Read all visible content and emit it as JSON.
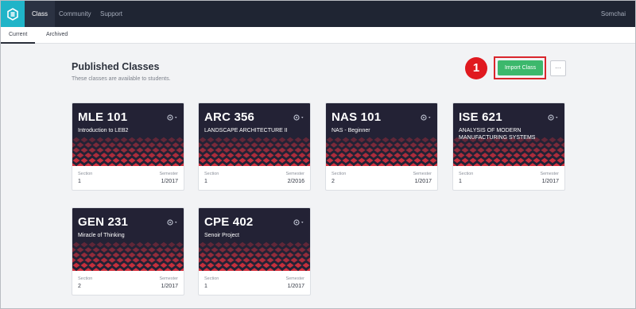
{
  "topnav": {
    "items": [
      "Class",
      "Community",
      "Support"
    ],
    "user": "Somchai"
  },
  "subnav": {
    "tabs": [
      "Current",
      "Archived"
    ]
  },
  "page": {
    "title": "Published Classes",
    "subtitle": "These classes are available to students."
  },
  "actions": {
    "marker": "1",
    "import_label": "Import Class",
    "more_label": "···"
  },
  "card_labels": {
    "section": "Section",
    "semester": "Semester"
  },
  "classes": [
    {
      "code": "MLE 101",
      "name": "Introduction to LEB2",
      "section": "1",
      "semester": "1/2017"
    },
    {
      "code": "ARC 356",
      "name": "LANDSCAPE ARCHITECTURE II",
      "section": "1",
      "semester": "2/2016"
    },
    {
      "code": "NAS 101",
      "name": "NAS - Beginner",
      "section": "2",
      "semester": "1/2017"
    },
    {
      "code": "ISE 621",
      "name": "ANALYSIS OF MODERN MANUFACTURING SYSTEMS",
      "section": "1",
      "semester": "1/2017"
    },
    {
      "code": "GEN 231",
      "name": "Miracle of Thinking",
      "section": "2",
      "semester": "1/2017"
    },
    {
      "code": "CPE 402",
      "name": "Senoir Project",
      "section": "1",
      "semester": "1/2017"
    }
  ],
  "colors": {
    "topbar": "#1f2533",
    "logo": "#20b4c8",
    "accent_green": "#3cb86c",
    "marker_red": "#e0191f",
    "card_head": "#232235",
    "pattern_red": "#d6323f"
  }
}
